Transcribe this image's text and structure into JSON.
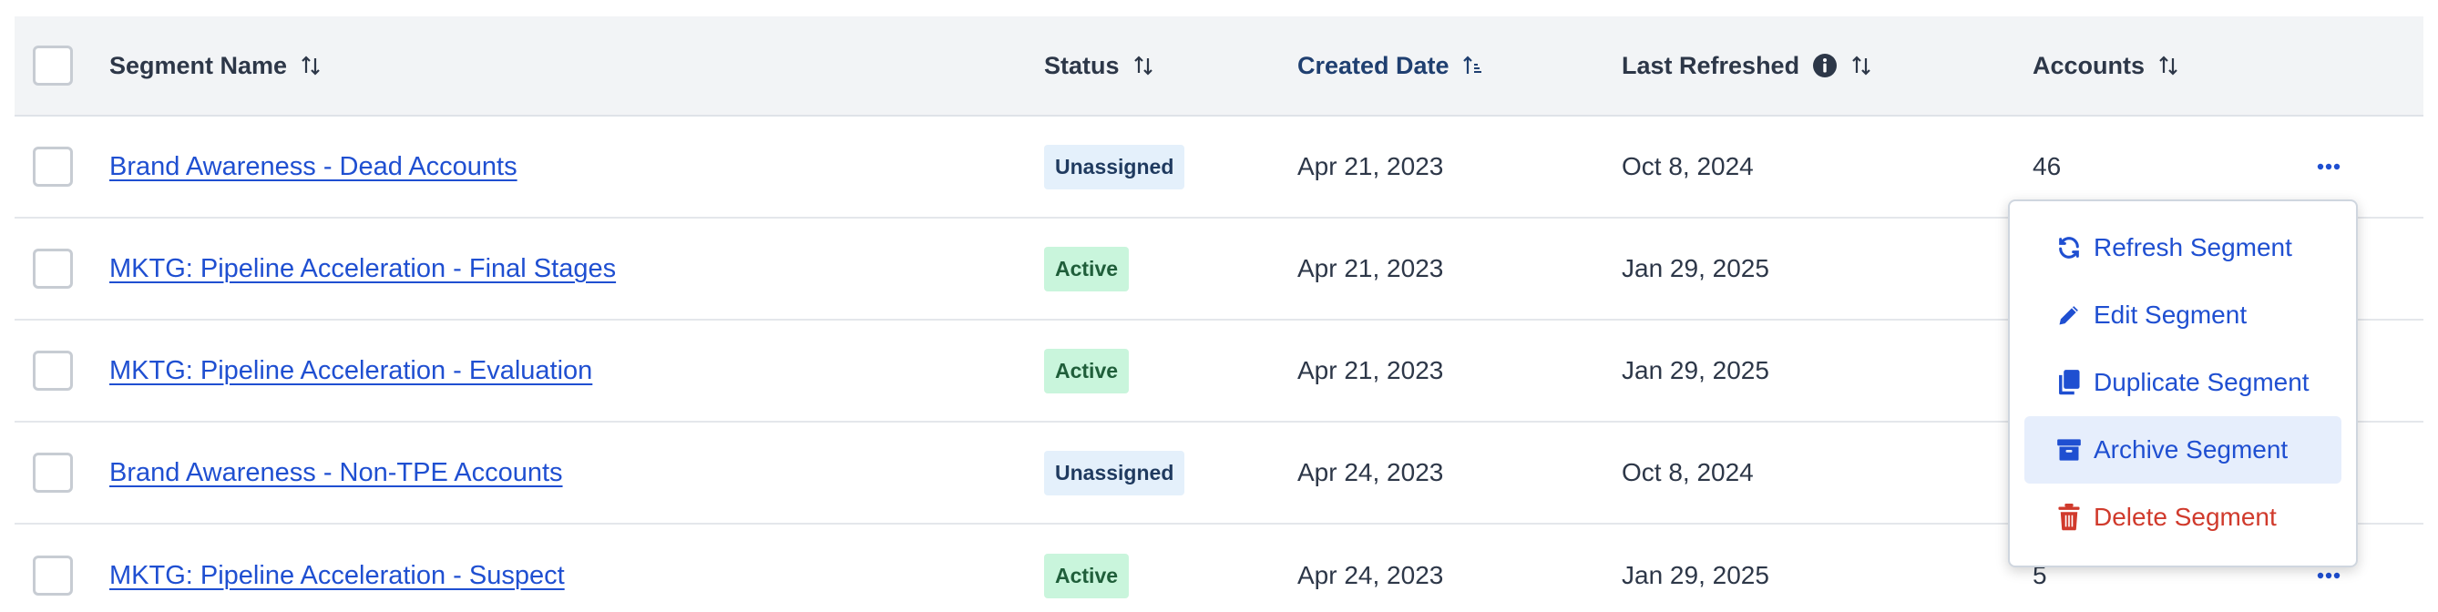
{
  "header": {
    "segment_name": "Segment Name",
    "status": "Status",
    "created_date": "Created Date",
    "last_refreshed": "Last Refreshed",
    "accounts": "Accounts"
  },
  "rows": [
    {
      "name": "Brand Awareness - Dead Accounts",
      "status": "Unassigned",
      "created": "Apr 21, 2023",
      "refreshed": "Oct 8, 2024",
      "accounts": "46"
    },
    {
      "name": "MKTG: Pipeline Acceleration - Final Stages",
      "status": "Active",
      "created": "Apr 21, 2023",
      "refreshed": "Jan 29, 2025",
      "accounts": ""
    },
    {
      "name": "MKTG: Pipeline Acceleration - Evaluation",
      "status": "Active",
      "created": "Apr 21, 2023",
      "refreshed": "Jan 29, 2025",
      "accounts": ""
    },
    {
      "name": "Brand Awareness - Non-TPE Accounts",
      "status": "Unassigned",
      "created": "Apr 24, 2023",
      "refreshed": "Oct 8, 2024",
      "accounts": ""
    },
    {
      "name": "MKTG: Pipeline Acceleration - Suspect",
      "status": "Active",
      "created": "Apr 24, 2023",
      "refreshed": "Jan 29, 2025",
      "accounts": "5"
    }
  ],
  "menu": {
    "items": [
      {
        "label": "Refresh Segment",
        "icon": "refresh-icon"
      },
      {
        "label": "Edit Segment",
        "icon": "pencil-icon"
      },
      {
        "label": "Duplicate Segment",
        "icon": "copy-icon"
      },
      {
        "label": "Archive Segment",
        "icon": "archive-icon"
      },
      {
        "label": "Delete Segment",
        "icon": "trash-icon"
      }
    ]
  },
  "colors": {
    "link": "#1f4fd1",
    "danger": "#d03a2c",
    "active_badge_bg": "#c9f5dc",
    "unassigned_badge_bg": "#e4f0fb",
    "header_bg": "#f2f4f6"
  }
}
